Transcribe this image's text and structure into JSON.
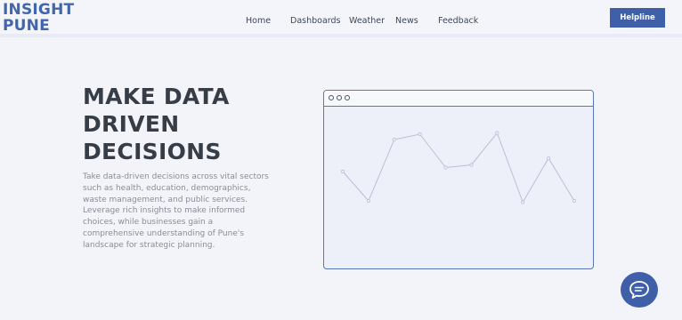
{
  "brand": {
    "line1": "INSIGHT",
    "line2": "PUNE",
    "color": "#4266ad"
  },
  "nav": {
    "items": [
      {
        "label": "Home"
      },
      {
        "label": "Dashboards"
      },
      {
        "label": "Weather"
      },
      {
        "label": "News"
      },
      {
        "label": "Feedback"
      }
    ]
  },
  "header": {
    "helpline_label": "Helpline",
    "button_color": "#3f5fa8"
  },
  "hero": {
    "title_lines": [
      "MAKE DATA",
      "DRIVEN",
      "DECISIONS"
    ],
    "description": "Take data-driven decisions across vital sectors such as health, education, demographics, waste management, and public services. Leverage rich insights to make informed choices, while businesses gain a comprehensive understanding of Pune's landscape for strategic planning."
  },
  "illustration": {
    "window_dots": 3,
    "chart_data": {
      "type": "line",
      "values": [
        60,
        38,
        84,
        88,
        63,
        65,
        89,
        37,
        70,
        38
      ],
      "ylim": [
        0,
        100
      ],
      "line_color": "#b8bfd9"
    }
  },
  "chat": {
    "icon": "chat-bubble-icon"
  }
}
